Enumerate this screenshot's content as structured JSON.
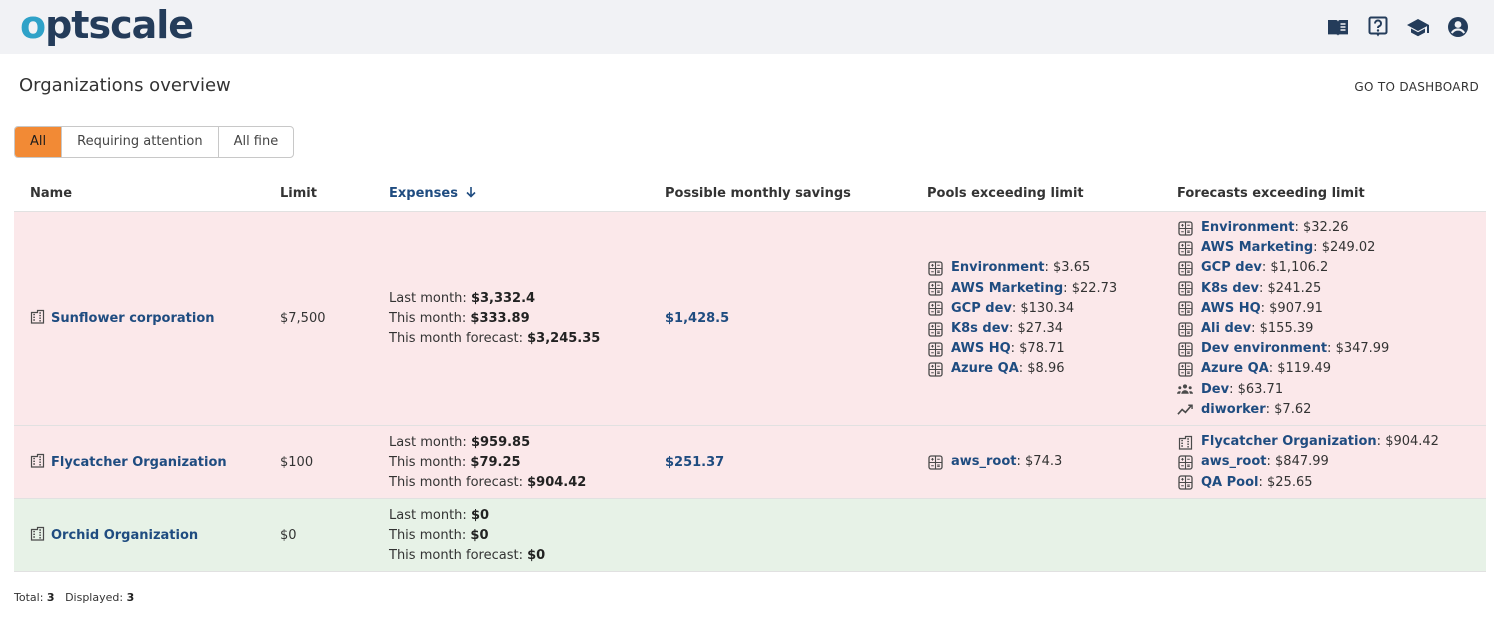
{
  "app": {
    "logo_prefix": "o",
    "logo_rest": "ptscale"
  },
  "header": {
    "icons": [
      "documentation-icon",
      "help-icon",
      "graduation-cap-icon",
      "account-icon"
    ]
  },
  "page": {
    "title": "Organizations overview",
    "dashboard_link": "GO TO DASHBOARD"
  },
  "filters": {
    "tabs": [
      "All",
      "Requiring attention",
      "All fine"
    ],
    "active": "All"
  },
  "table": {
    "columns": {
      "name": "Name",
      "limit": "Limit",
      "expenses": "Expenses",
      "savings": "Possible monthly savings",
      "pools": "Pools exceeding limit",
      "forecasts": "Forecasts exceeding limit"
    },
    "expense_labels": {
      "last": "Last month:",
      "this": "This month:",
      "forecast": "This month forecast:"
    },
    "rows": [
      {
        "status": "attention",
        "name": "Sunflower corporation",
        "limit": "$7,500",
        "last_month": "$3,332.4",
        "this_month": "$333.89",
        "forecast": "$3,245.35",
        "savings": "$1,428.5",
        "pools": [
          {
            "icon": "pool-icon",
            "name": "Environment",
            "value": "$3.65"
          },
          {
            "icon": "pool-icon",
            "name": "AWS Marketing",
            "value": "$22.73"
          },
          {
            "icon": "pool-icon",
            "name": "GCP dev",
            "value": "$130.34"
          },
          {
            "icon": "pool-icon",
            "name": "K8s dev",
            "value": "$27.34"
          },
          {
            "icon": "pool-icon",
            "name": "AWS HQ",
            "value": "$78.71"
          },
          {
            "icon": "pool-icon",
            "name": "Azure QA",
            "value": "$8.96"
          }
        ],
        "forecasts": [
          {
            "icon": "pool-icon",
            "name": "Environment",
            "value": "$32.26"
          },
          {
            "icon": "pool-icon",
            "name": "AWS Marketing",
            "value": "$249.02"
          },
          {
            "icon": "pool-icon",
            "name": "GCP dev",
            "value": "$1,106.2"
          },
          {
            "icon": "pool-icon",
            "name": "K8s dev",
            "value": "$241.25"
          },
          {
            "icon": "pool-icon",
            "name": "AWS HQ",
            "value": "$907.91"
          },
          {
            "icon": "pool-icon",
            "name": "Ali dev",
            "value": "$155.39"
          },
          {
            "icon": "pool-icon",
            "name": "Dev environment",
            "value": "$347.99"
          },
          {
            "icon": "pool-icon",
            "name": "Azure QA",
            "value": "$119.49"
          },
          {
            "icon": "team-icon",
            "name": "Dev",
            "value": "$63.71"
          },
          {
            "icon": "trend-icon",
            "name": "diworker",
            "value": "$7.62"
          }
        ]
      },
      {
        "status": "attention",
        "name": "Flycatcher Organization",
        "limit": "$100",
        "last_month": "$959.85",
        "this_month": "$79.25",
        "forecast": "$904.42",
        "savings": "$251.37",
        "pools": [
          {
            "icon": "pool-icon",
            "name": "aws_root",
            "value": "$74.3"
          }
        ],
        "forecasts": [
          {
            "icon": "building-icon",
            "name": "Flycatcher Organization",
            "value": "$904.42"
          },
          {
            "icon": "pool-icon",
            "name": "aws_root",
            "value": "$847.99"
          },
          {
            "icon": "pool-icon",
            "name": "QA Pool",
            "value": "$25.65"
          }
        ]
      },
      {
        "status": "fine",
        "name": "Orchid Organization",
        "limit": "$0",
        "last_month": "$0",
        "this_month": "$0",
        "forecast": "$0",
        "savings": "",
        "pools": [],
        "forecasts": []
      }
    ]
  },
  "footer": {
    "total_label": "Total:",
    "total": "3",
    "displayed_label": "Displayed:",
    "displayed": "3"
  },
  "colors": {
    "active_tab": "#f28a35",
    "link": "#1f4c80",
    "row_attention": "#fbe8ea",
    "row_fine": "#e7f2e7",
    "brand_dark": "#243c5a",
    "brand_accent": "#2fa2c8"
  }
}
